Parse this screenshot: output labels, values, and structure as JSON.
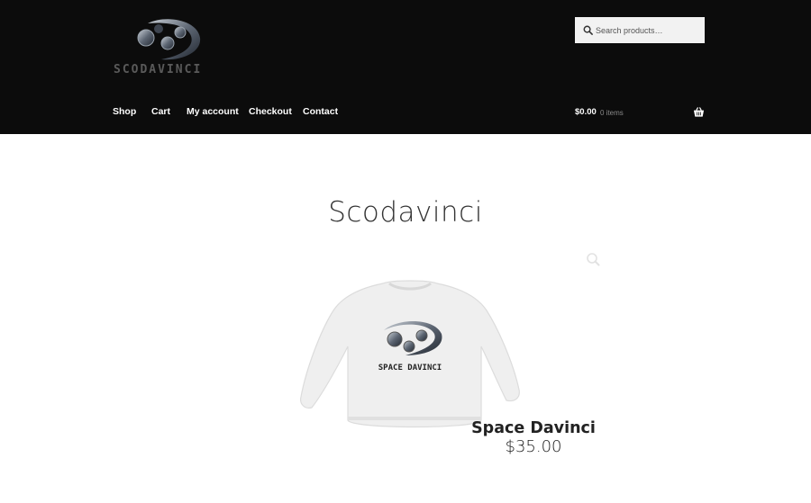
{
  "site": {
    "logo_text": "SCODAVINCI"
  },
  "search": {
    "placeholder": "Search products…"
  },
  "nav": {
    "items": [
      "Shop",
      "Cart",
      "My account",
      "Checkout",
      "Contact"
    ]
  },
  "cart": {
    "total": "$0.00",
    "count": "0 items"
  },
  "page": {
    "title": "Scodavinci"
  },
  "product": {
    "name": "Space Davinci",
    "price": "$35.00",
    "print_text": "SPACE DAVINCI"
  },
  "icons": [
    "search-icon",
    "basket-icon",
    "zoom-icon"
  ],
  "colors": {
    "header_bg": "#0c0c0c",
    "nav_text": "#ffffff",
    "search_bg": "#f2f2f2"
  }
}
